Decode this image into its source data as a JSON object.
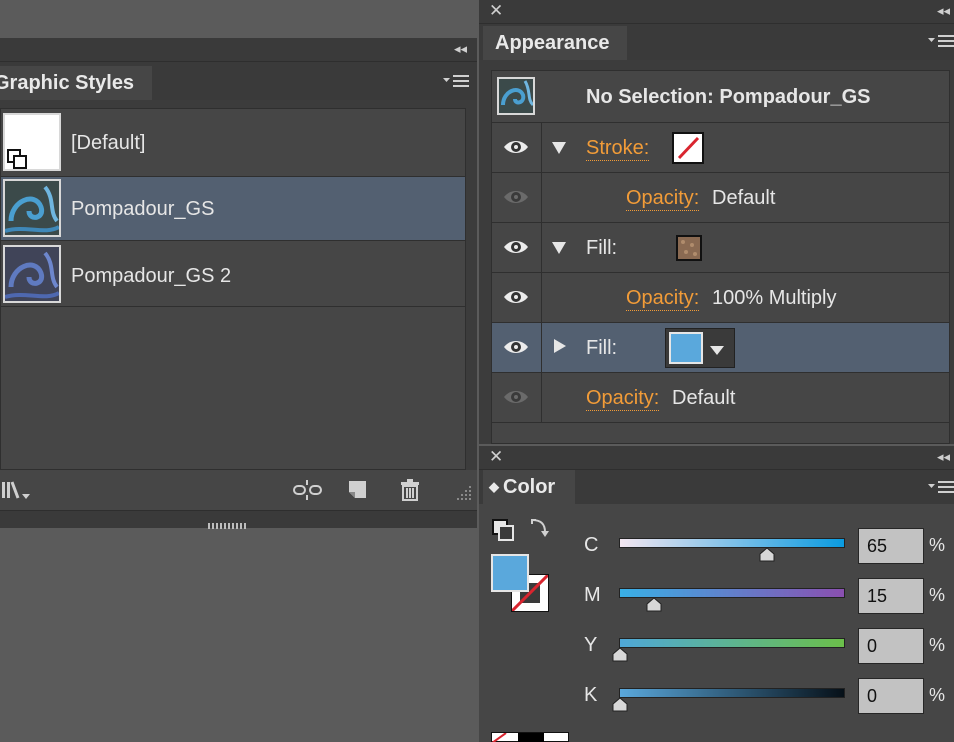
{
  "graphic_styles": {
    "tab_label": "Graphic Styles",
    "items": [
      {
        "label": "[Default]"
      },
      {
        "label": "Pompadour_GS"
      },
      {
        "label": "Pompadour_GS 2"
      }
    ],
    "selected_index": 1
  },
  "appearance": {
    "tab_label": "Appearance",
    "header_text": "No Selection: Pompadour_GS",
    "rows": [
      {
        "label": "Stroke:",
        "kind": "stroke"
      },
      {
        "label": "Opacity:",
        "value": "Default",
        "kind": "opacity"
      },
      {
        "label": "Fill:",
        "kind": "fill"
      },
      {
        "label": "Opacity:",
        "value": "100% Multiply",
        "kind": "opacity"
      },
      {
        "label": "Fill:",
        "kind": "fill-selected"
      },
      {
        "label": "Opacity:",
        "value": "Default",
        "kind": "opacity-global"
      }
    ]
  },
  "color": {
    "tab_label": "Color",
    "channels": [
      {
        "name": "C",
        "value": "65",
        "unit": "%",
        "level": 0.65
      },
      {
        "name": "M",
        "value": "15",
        "unit": "%",
        "level": 0.15
      },
      {
        "name": "Y",
        "value": "0",
        "unit": "%",
        "level": 0.0
      },
      {
        "name": "K",
        "value": "0",
        "unit": "%",
        "level": 0.0
      }
    ],
    "fill_color": "#5aa8dc"
  },
  "colors": {
    "accent_orange": "#f29c38",
    "selected_row": "#536071",
    "fill_swatch": "#5aa8dc"
  }
}
